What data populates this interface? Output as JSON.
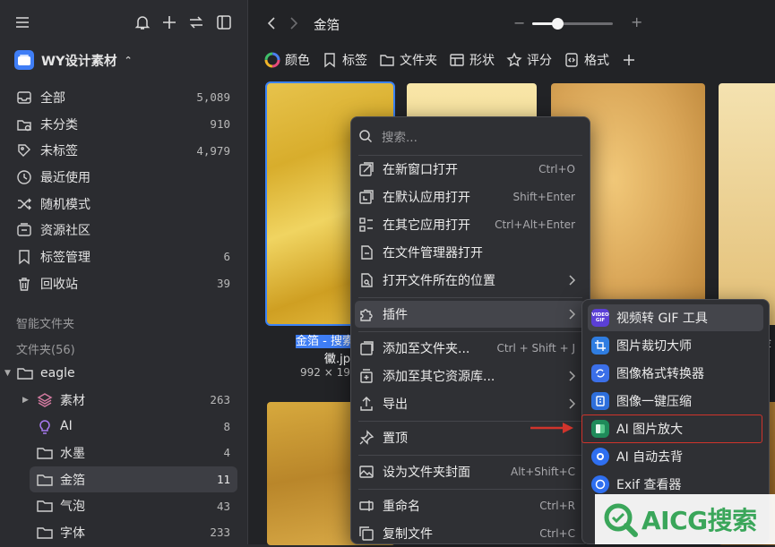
{
  "library": {
    "name": "WY设计素材"
  },
  "nav": [
    {
      "label": "全部",
      "count": "5,089"
    },
    {
      "label": "未分类",
      "count": "910"
    },
    {
      "label": "未标签",
      "count": "4,979"
    },
    {
      "label": "最近使用",
      "count": ""
    },
    {
      "label": "随机模式",
      "count": ""
    },
    {
      "label": "资源社区",
      "count": ""
    },
    {
      "label": "标签管理",
      "count": "6"
    },
    {
      "label": "回收站",
      "count": "39"
    }
  ],
  "sections": {
    "smart_folders": "智能文件夹",
    "folders": "文件夹(56)"
  },
  "tree": {
    "root": "eagle",
    "items": [
      {
        "label": "素材",
        "count": "263"
      },
      {
        "label": "AI",
        "count": "8"
      },
      {
        "label": "水墨",
        "count": "4"
      },
      {
        "label": "金箔",
        "count": "11"
      },
      {
        "label": "气泡",
        "count": "43"
      },
      {
        "label": "字体",
        "count": "233"
      }
    ]
  },
  "toolbar": {
    "breadcrumb": "金箔"
  },
  "filters": [
    {
      "label": "颜色"
    },
    {
      "label": "标签"
    },
    {
      "label": "文件夹"
    },
    {
      "label": "形状"
    },
    {
      "label": "评分"
    },
    {
      "label": "格式"
    }
  ],
  "selected_file": {
    "name_line1": "金箔 - 搜索结",
    "name_line2": "黴.jpg",
    "dimensions": "992 × 192"
  },
  "side_item": {
    "name": "金",
    "sub": "8"
  },
  "context_menu": {
    "search_placeholder": "搜索...",
    "items": [
      {
        "label": "在新窗口打开",
        "shortcut": "Ctrl+O"
      },
      {
        "label": "在默认应用打开",
        "shortcut": "Shift+Enter"
      },
      {
        "label": "在其它应用打开",
        "shortcut": "Ctrl+Alt+Enter"
      },
      {
        "label": "在文件管理器打开",
        "shortcut": ""
      },
      {
        "label": "打开文件所在的位置",
        "shortcut": ""
      },
      {
        "label": "插件",
        "shortcut": ""
      },
      {
        "label": "添加至文件夹...",
        "shortcut": "Ctrl + Shift + J"
      },
      {
        "label": "添加至其它资源库...",
        "shortcut": ""
      },
      {
        "label": "导出",
        "shortcut": ""
      },
      {
        "label": "置顶",
        "shortcut": ""
      },
      {
        "label": "设为文件夹封面",
        "shortcut": "Alt+Shift+C"
      },
      {
        "label": "重命名",
        "shortcut": "Ctrl+R"
      },
      {
        "label": "复制文件",
        "shortcut": "Ctrl+C"
      }
    ]
  },
  "plugin_menu": {
    "items": [
      {
        "label": "视频转 GIF 工具",
        "icon_text": "VIDEO GIF",
        "color": "#5b3fd6"
      },
      {
        "label": "图片裁切大师",
        "icon_text": "",
        "color": "#2f7de1"
      },
      {
        "label": "图像格式转换器",
        "icon_text": "",
        "color": "#3b6fe8"
      },
      {
        "label": "图像一键压缩",
        "icon_text": "",
        "color": "#2e6fdc"
      },
      {
        "label": "AI 图片放大",
        "icon_text": "",
        "color": "#1f8a5a"
      },
      {
        "label": "AI 自动去背",
        "icon_text": "",
        "color": "#2f6ff0"
      },
      {
        "label": "Exif 查看器",
        "icon_text": "",
        "color": "#2f6ff0"
      }
    ]
  },
  "watermark": {
    "text": "AICG搜索"
  },
  "colors": {
    "accent": "#3f7ef6",
    "highlight_box": "#d0342c",
    "arrow": "#d0342c"
  }
}
